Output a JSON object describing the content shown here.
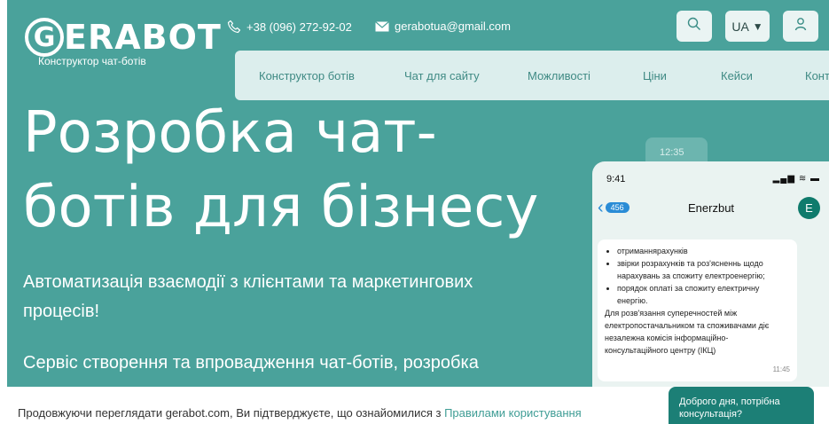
{
  "brand": {
    "logo_letter": "G",
    "logo_text": "ERABOT",
    "tagline": "Конструктор чат-ботів"
  },
  "contacts": {
    "phone": "+38 (096) 272-92-02",
    "email": "gerabotua@gmail.com"
  },
  "header": {
    "language": "UA",
    "search_icon": "search-icon",
    "user_icon": "user-icon"
  },
  "nav": {
    "items": [
      {
        "label": "Конструктор ботів"
      },
      {
        "label": "Чат для сайту"
      },
      {
        "label": "Можливості"
      },
      {
        "label": "Ціни"
      },
      {
        "label": "Кейси"
      },
      {
        "label": "Конта"
      }
    ]
  },
  "hero": {
    "headline_line1": "Розробка чат-",
    "headline_line2": "ботів для бізнесу",
    "para1_line1": "Автоматизація взаємодії з клієнтами та маркетингових",
    "para1_line2": "процесів!",
    "para2_line1": "Сервіс створення та впровадження чат-ботів, розробка"
  },
  "phone": {
    "back_time": "12:35",
    "time": "9:41",
    "status": "▂▄▆ ≋ ▬",
    "back_badge": "456",
    "contact_name": "Enerzbut",
    "avatar_letter": "E",
    "message": {
      "items": [
        "отриманнярахунків",
        "звірки розрахунків та роз'ясненнь щодо нарахувань за спожиту електроенергію;",
        "порядок оплаті за спожиту електричну енергію."
      ],
      "paragraph": "Для розв'язання суперечностей між електропостачальником та споживачами діє незалежна комісія інформаційно-консультаційного центру (ІКЦ)",
      "time": "11:45"
    }
  },
  "cookie": {
    "text": "Продовжуючи переглядати gerabot.com, Ви підтверджуєте, що ознайомилися з",
    "link": "Правилами користування"
  },
  "chat_widget": {
    "text": "Доброго дня, потрібна консультація?"
  },
  "colors": {
    "hero_bg": "#4aa29b",
    "nav_bg": "#dceeed",
    "nav_text": "#3f8a84",
    "accent_dark": "#1c7f76",
    "link": "#3f9d95"
  }
}
